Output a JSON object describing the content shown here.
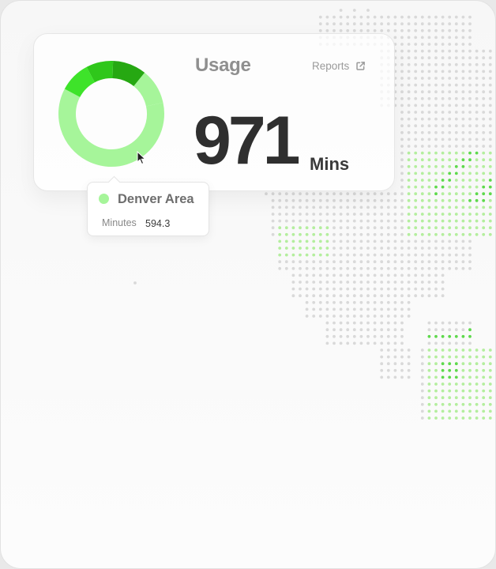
{
  "widget": {
    "title": "Usage",
    "reports_label": "Reports",
    "metric_value": "971",
    "metric_unit": "Mins"
  },
  "tooltip": {
    "region": "Denver Area",
    "metric_label": "Minutes",
    "metric_value": "594.3"
  },
  "donut": {
    "segments": [
      {
        "value": 594.3,
        "color": "#a6f59a"
      },
      {
        "value": 92,
        "color": "#3ee32a"
      },
      {
        "value": 80,
        "color": "#2fc71b"
      },
      {
        "value": 100,
        "color": "#26a812"
      },
      {
        "value": 104.7,
        "color": "#a6f59a"
      }
    ],
    "order": [
      1,
      2,
      3,
      4,
      0
    ]
  },
  "colors": {
    "accent_light": "#a6f59a",
    "accent": "#3ee32a",
    "accent_dark": "#26a812",
    "map_dot": "#d9d9d9",
    "map_dot_highlight": "#b4ee9e",
    "map_dot_active": "#5ed94c"
  },
  "icons": {
    "reports": "external-link-icon",
    "cursor": "pointer-cursor-icon"
  }
}
